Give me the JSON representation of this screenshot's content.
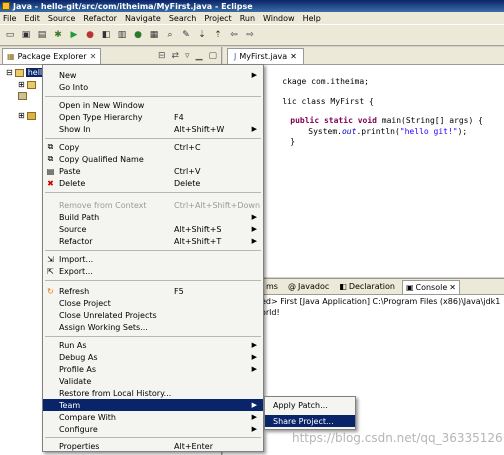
{
  "window": {
    "title": "Java - hello-git/src/com/itheima/MyFirst.java - Eclipse"
  },
  "menubar": [
    "File",
    "Edit",
    "Source",
    "Refactor",
    "Navigate",
    "Search",
    "Project",
    "Run",
    "Window",
    "Help"
  ],
  "package_explorer": {
    "tab_label": "Package Explorer",
    "selected_project": "hell"
  },
  "editor": {
    "tab_label": "MyFirst.java",
    "line_package": "ckage com.itheima;",
    "line_class": "lic class MyFirst {",
    "line_main_kw": "public static void",
    "line_main_rest": " main(String[] args) {",
    "line_print_a": "System.",
    "line_print_b": "out",
    "line_print_c": ".println(",
    "line_print_str": "\"hello git!\"",
    "line_print_d": ");",
    "line_close": "}"
  },
  "console": {
    "tabs": [
      "ms",
      "Javadoc",
      "Declaration",
      "Console"
    ],
    "line1": "ed> First [Java Application] C:\\Program Files (x86)\\Java\\jdk1",
    "line2": "orld!"
  },
  "context_menu": {
    "items": [
      {
        "label": "New",
        "shortcut": "",
        "submenu": true
      },
      {
        "label": "Go Into",
        "shortcut": ""
      },
      {
        "label": "Open in New Window",
        "shortcut": ""
      },
      {
        "label": "Open Type Hierarchy",
        "shortcut": "F4"
      },
      {
        "label": "Show In",
        "shortcut": "Alt+Shift+W",
        "submenu": true
      },
      {
        "label": "Copy",
        "shortcut": "Ctrl+C"
      },
      {
        "label": "Copy Qualified Name",
        "shortcut": ""
      },
      {
        "label": "Paste",
        "shortcut": "Ctrl+V"
      },
      {
        "label": "Delete",
        "shortcut": "Delete"
      },
      {
        "label": "Remove from Context",
        "shortcut": "Ctrl+Alt+Shift+Down"
      },
      {
        "label": "Build Path",
        "shortcut": "",
        "submenu": true
      },
      {
        "label": "Source",
        "shortcut": "Alt+Shift+S",
        "submenu": true
      },
      {
        "label": "Refactor",
        "shortcut": "Alt+Shift+T",
        "submenu": true
      },
      {
        "label": "Import...",
        "shortcut": ""
      },
      {
        "label": "Export...",
        "shortcut": ""
      },
      {
        "label": "Refresh",
        "shortcut": "F5"
      },
      {
        "label": "Close Project",
        "shortcut": ""
      },
      {
        "label": "Close Unrelated Projects",
        "shortcut": ""
      },
      {
        "label": "Assign Working Sets...",
        "shortcut": ""
      },
      {
        "label": "Run As",
        "shortcut": "",
        "submenu": true
      },
      {
        "label": "Debug As",
        "shortcut": "",
        "submenu": true
      },
      {
        "label": "Profile As",
        "shortcut": "",
        "submenu": true
      },
      {
        "label": "Validate",
        "shortcut": ""
      },
      {
        "label": "Restore from Local History...",
        "shortcut": ""
      },
      {
        "label": "Team",
        "shortcut": "",
        "submenu": true
      },
      {
        "label": "Compare With",
        "shortcut": "",
        "submenu": true
      },
      {
        "label": "Configure",
        "shortcut": "",
        "submenu": true
      },
      {
        "label": "Properties",
        "shortcut": "Alt+Enter"
      }
    ]
  },
  "team_submenu": {
    "items": [
      {
        "label": "Apply Patch..."
      },
      {
        "label": "Share Project..."
      }
    ]
  },
  "watermark": "https://blog.csdn.net/qq_36335126"
}
